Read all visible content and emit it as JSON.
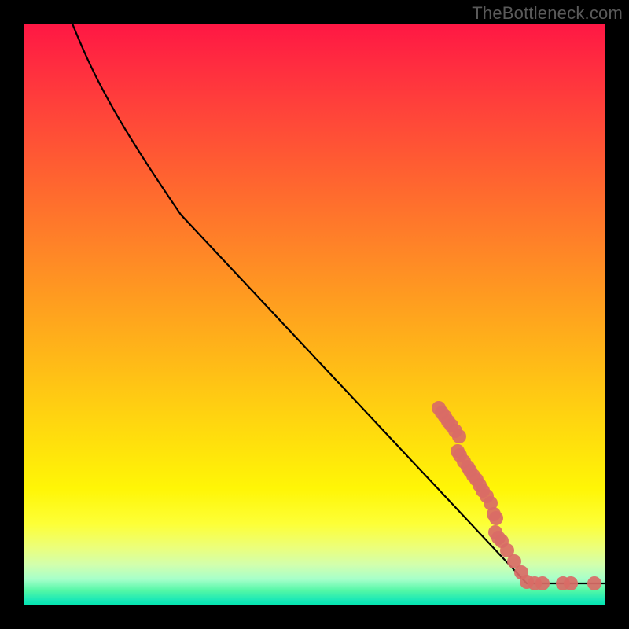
{
  "watermark": "TheBottleneck.com",
  "chart_data": {
    "type": "line",
    "title": "",
    "xlabel": "",
    "ylabel": "",
    "xlim": [
      0,
      100
    ],
    "ylim": [
      0,
      100
    ],
    "background": "vertical-gradient red→yellow→green",
    "series": [
      {
        "name": "curve",
        "style": "black-line",
        "points": [
          {
            "x": 8.4,
            "y": 100.0
          },
          {
            "x": 10.3,
            "y": 95.3
          },
          {
            "x": 12.2,
            "y": 91.2
          },
          {
            "x": 14.2,
            "y": 87.6
          },
          {
            "x": 16.2,
            "y": 83.8
          },
          {
            "x": 20.3,
            "y": 77.0
          },
          {
            "x": 27.0,
            "y": 67.2
          },
          {
            "x": 86.5,
            "y": 3.8
          },
          {
            "x": 100.0,
            "y": 3.8
          }
        ]
      },
      {
        "name": "highlighted-points",
        "style": "salmon-scatter",
        "points": [
          {
            "x": 71.4,
            "y": 33.9
          },
          {
            "x": 71.9,
            "y": 33.1
          },
          {
            "x": 72.4,
            "y": 32.4
          },
          {
            "x": 73.0,
            "y": 31.6
          },
          {
            "x": 73.5,
            "y": 30.9
          },
          {
            "x": 74.2,
            "y": 30.0
          },
          {
            "x": 74.9,
            "y": 29.1
          },
          {
            "x": 74.6,
            "y": 26.5
          },
          {
            "x": 75.0,
            "y": 25.8
          },
          {
            "x": 75.7,
            "y": 24.7
          },
          {
            "x": 76.4,
            "y": 23.8
          },
          {
            "x": 76.8,
            "y": 23.1
          },
          {
            "x": 77.3,
            "y": 22.3
          },
          {
            "x": 77.8,
            "y": 21.6
          },
          {
            "x": 78.4,
            "y": 20.7
          },
          {
            "x": 78.9,
            "y": 19.7
          },
          {
            "x": 79.6,
            "y": 18.8
          },
          {
            "x": 80.3,
            "y": 17.6
          },
          {
            "x": 80.8,
            "y": 15.7
          },
          {
            "x": 81.2,
            "y": 15.0
          },
          {
            "x": 81.1,
            "y": 12.6
          },
          {
            "x": 81.6,
            "y": 11.6
          },
          {
            "x": 82.2,
            "y": 11.1
          },
          {
            "x": 83.1,
            "y": 9.5
          },
          {
            "x": 84.3,
            "y": 7.6
          },
          {
            "x": 85.5,
            "y": 5.7
          },
          {
            "x": 86.5,
            "y": 4.1
          },
          {
            "x": 87.8,
            "y": 3.8
          },
          {
            "x": 89.2,
            "y": 3.8
          },
          {
            "x": 92.7,
            "y": 3.8
          },
          {
            "x": 94.1,
            "y": 3.8
          },
          {
            "x": 98.1,
            "y": 3.8
          }
        ]
      }
    ]
  }
}
